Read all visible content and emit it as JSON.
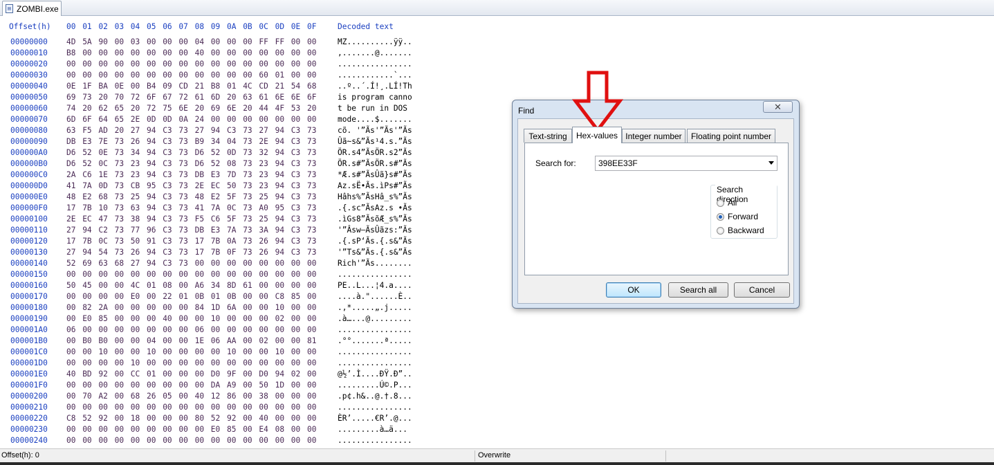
{
  "tab": {
    "label": "ZOMBI.exe",
    "icon": "file-icon"
  },
  "header": {
    "offset_label": "Offset(h)",
    "columns": [
      "00",
      "01",
      "02",
      "03",
      "04",
      "05",
      "06",
      "07",
      "08",
      "09",
      "0A",
      "0B",
      "0C",
      "0D",
      "0E",
      "0F"
    ],
    "decoded_label": "Decoded text"
  },
  "rows": [
    {
      "offset": "00000000",
      "bytes": [
        "4D",
        "5A",
        "90",
        "00",
        "03",
        "00",
        "00",
        "00",
        "04",
        "00",
        "00",
        "00",
        "FF",
        "FF",
        "00",
        "00"
      ],
      "text": "MZ..........ÿÿ.."
    },
    {
      "offset": "00000010",
      "bytes": [
        "B8",
        "00",
        "00",
        "00",
        "00",
        "00",
        "00",
        "00",
        "40",
        "00",
        "00",
        "00",
        "00",
        "00",
        "00",
        "00"
      ],
      "text": ",.......@......."
    },
    {
      "offset": "00000020",
      "bytes": [
        "00",
        "00",
        "00",
        "00",
        "00",
        "00",
        "00",
        "00",
        "00",
        "00",
        "00",
        "00",
        "00",
        "00",
        "00",
        "00"
      ],
      "text": "................"
    },
    {
      "offset": "00000030",
      "bytes": [
        "00",
        "00",
        "00",
        "00",
        "00",
        "00",
        "00",
        "00",
        "00",
        "00",
        "00",
        "00",
        "60",
        "01",
        "00",
        "00"
      ],
      "text": "............`..."
    },
    {
      "offset": "00000040",
      "bytes": [
        "0E",
        "1F",
        "BA",
        "0E",
        "00",
        "B4",
        "09",
        "CD",
        "21",
        "B8",
        "01",
        "4C",
        "CD",
        "21",
        "54",
        "68"
      ],
      "text": "..º..´.Í!¸.LÍ!Th"
    },
    {
      "offset": "00000050",
      "bytes": [
        "69",
        "73",
        "20",
        "70",
        "72",
        "6F",
        "67",
        "72",
        "61",
        "6D",
        "20",
        "63",
        "61",
        "6E",
        "6E",
        "6F"
      ],
      "text": "is program canno"
    },
    {
      "offset": "00000060",
      "bytes": [
        "74",
        "20",
        "62",
        "65",
        "20",
        "72",
        "75",
        "6E",
        "20",
        "69",
        "6E",
        "20",
        "44",
        "4F",
        "53",
        "20"
      ],
      "text": "t be run in DOS "
    },
    {
      "offset": "00000070",
      "bytes": [
        "6D",
        "6F",
        "64",
        "65",
        "2E",
        "0D",
        "0D",
        "0A",
        "24",
        "00",
        "00",
        "00",
        "00",
        "00",
        "00",
        "00"
      ],
      "text": "mode....$......."
    },
    {
      "offset": "00000080",
      "bytes": [
        "63",
        "F5",
        "AD",
        "20",
        "27",
        "94",
        "C3",
        "73",
        "27",
        "94",
        "C3",
        "73",
        "27",
        "94",
        "C3",
        "73"
      ],
      "text": "cõ. '”Ãs'”Ãs'”Ãs"
    },
    {
      "offset": "00000090",
      "bytes": [
        "DB",
        "E3",
        "7E",
        "73",
        "26",
        "94",
        "C3",
        "73",
        "B9",
        "34",
        "04",
        "73",
        "2E",
        "94",
        "C3",
        "73"
      ],
      "text": "Ûã~s&”Ãs¹4.s.”Ãs"
    },
    {
      "offset": "000000A0",
      "bytes": [
        "D6",
        "52",
        "0E",
        "73",
        "34",
        "94",
        "C3",
        "73",
        "D6",
        "52",
        "0D",
        "73",
        "32",
        "94",
        "C3",
        "73"
      ],
      "text": "ÖR.s4”ÃsÖR.s2”Ãs"
    },
    {
      "offset": "000000B0",
      "bytes": [
        "D6",
        "52",
        "0C",
        "73",
        "23",
        "94",
        "C3",
        "73",
        "D6",
        "52",
        "08",
        "73",
        "23",
        "94",
        "C3",
        "73"
      ],
      "text": "ÖR.s#”ÃsÖR.s#”Ãs"
    },
    {
      "offset": "000000C0",
      "bytes": [
        "2A",
        "C6",
        "1E",
        "73",
        "23",
        "94",
        "C3",
        "73",
        "DB",
        "E3",
        "7D",
        "73",
        "23",
        "94",
        "C3",
        "73"
      ],
      "text": "*Æ.s#”ÃsÛã}s#”Ãs"
    },
    {
      "offset": "000000D0",
      "bytes": [
        "41",
        "7A",
        "0D",
        "73",
        "CB",
        "95",
        "C3",
        "73",
        "2E",
        "EC",
        "50",
        "73",
        "23",
        "94",
        "C3",
        "73"
      ],
      "text": "Az.sË•Ãs.ìPs#”Ãs"
    },
    {
      "offset": "000000E0",
      "bytes": [
        "48",
        "E2",
        "68",
        "73",
        "25",
        "94",
        "C3",
        "73",
        "48",
        "E2",
        "5F",
        "73",
        "25",
        "94",
        "C3",
        "73"
      ],
      "text": "Hâhs%”ÃsHâ_s%”Ãs"
    },
    {
      "offset": "000000F0",
      "bytes": [
        "17",
        "7B",
        "10",
        "73",
        "63",
        "94",
        "C3",
        "73",
        "41",
        "7A",
        "0C",
        "73",
        "A0",
        "95",
        "C3",
        "73"
      ],
      "text": ".{.sc”ÃsAz.s •Ãs"
    },
    {
      "offset": "00000100",
      "bytes": [
        "2E",
        "EC",
        "47",
        "73",
        "38",
        "94",
        "C3",
        "73",
        "F5",
        "C6",
        "5F",
        "73",
        "25",
        "94",
        "C3",
        "73"
      ],
      "text": ".ìGs8”ÃsõÆ_s%”Ãs"
    },
    {
      "offset": "00000110",
      "bytes": [
        "27",
        "94",
        "C2",
        "73",
        "77",
        "96",
        "C3",
        "73",
        "DB",
        "E3",
        "7A",
        "73",
        "3A",
        "94",
        "C3",
        "73"
      ],
      "text": "'”Âsw–ÃsÛãzs:”Ãs"
    },
    {
      "offset": "00000120",
      "bytes": [
        "17",
        "7B",
        "0C",
        "73",
        "50",
        "91",
        "C3",
        "73",
        "17",
        "7B",
        "0A",
        "73",
        "26",
        "94",
        "C3",
        "73"
      ],
      "text": ".{.sP‘Ãs.{.s&”Ãs"
    },
    {
      "offset": "00000130",
      "bytes": [
        "27",
        "94",
        "54",
        "73",
        "26",
        "94",
        "C3",
        "73",
        "17",
        "7B",
        "0F",
        "73",
        "26",
        "94",
        "C3",
        "73"
      ],
      "text": "'”Ts&”Ãs.{.s&”Ãs"
    },
    {
      "offset": "00000140",
      "bytes": [
        "52",
        "69",
        "63",
        "68",
        "27",
        "94",
        "C3",
        "73",
        "00",
        "00",
        "00",
        "00",
        "00",
        "00",
        "00",
        "00"
      ],
      "text": "Rich'”Ãs........"
    },
    {
      "offset": "00000150",
      "bytes": [
        "00",
        "00",
        "00",
        "00",
        "00",
        "00",
        "00",
        "00",
        "00",
        "00",
        "00",
        "00",
        "00",
        "00",
        "00",
        "00"
      ],
      "text": "................"
    },
    {
      "offset": "00000160",
      "bytes": [
        "50",
        "45",
        "00",
        "00",
        "4C",
        "01",
        "08",
        "00",
        "A6",
        "34",
        "8D",
        "61",
        "00",
        "00",
        "00",
        "00"
      ],
      "text": "PE..L...¦4.a...."
    },
    {
      "offset": "00000170",
      "bytes": [
        "00",
        "00",
        "00",
        "00",
        "E0",
        "00",
        "22",
        "01",
        "0B",
        "01",
        "0B",
        "00",
        "00",
        "C8",
        "85",
        "00"
      ],
      "text": "....à.\"......È.."
    },
    {
      "offset": "00000180",
      "bytes": [
        "00",
        "82",
        "2A",
        "00",
        "00",
        "00",
        "00",
        "00",
        "84",
        "1D",
        "6A",
        "00",
        "00",
        "10",
        "00",
        "00"
      ],
      "text": ".,*.....„.j....."
    },
    {
      "offset": "00000190",
      "bytes": [
        "00",
        "E0",
        "85",
        "00",
        "00",
        "00",
        "40",
        "00",
        "00",
        "10",
        "00",
        "00",
        "00",
        "02",
        "00",
        "00"
      ],
      "text": ".à…...@........."
    },
    {
      "offset": "000001A0",
      "bytes": [
        "06",
        "00",
        "00",
        "00",
        "00",
        "00",
        "00",
        "00",
        "06",
        "00",
        "00",
        "00",
        "00",
        "00",
        "00",
        "00"
      ],
      "text": "................"
    },
    {
      "offset": "000001B0",
      "bytes": [
        "00",
        "B0",
        "B0",
        "00",
        "00",
        "04",
        "00",
        "00",
        "1E",
        "06",
        "AA",
        "00",
        "02",
        "00",
        "00",
        "81"
      ],
      "text": ".°°.......ª....."
    },
    {
      "offset": "000001C0",
      "bytes": [
        "00",
        "00",
        "10",
        "00",
        "00",
        "10",
        "00",
        "00",
        "00",
        "00",
        "10",
        "00",
        "00",
        "10",
        "00",
        "00"
      ],
      "text": "................"
    },
    {
      "offset": "000001D0",
      "bytes": [
        "00",
        "00",
        "00",
        "00",
        "10",
        "00",
        "00",
        "00",
        "00",
        "00",
        "00",
        "00",
        "00",
        "00",
        "00",
        "00"
      ],
      "text": "................"
    },
    {
      "offset": "000001E0",
      "bytes": [
        "40",
        "BD",
        "92",
        "00",
        "CC",
        "01",
        "00",
        "00",
        "00",
        "D0",
        "9F",
        "00",
        "D0",
        "94",
        "02",
        "00"
      ],
      "text": "@½’.Ì....ÐŸ.Ð”.."
    },
    {
      "offset": "000001F0",
      "bytes": [
        "00",
        "00",
        "00",
        "00",
        "00",
        "00",
        "00",
        "00",
        "00",
        "DA",
        "A9",
        "00",
        "50",
        "1D",
        "00",
        "00"
      ],
      "text": ".........Ú©.P..."
    },
    {
      "offset": "00000200",
      "bytes": [
        "00",
        "70",
        "A2",
        "00",
        "68",
        "26",
        "05",
        "00",
        "40",
        "12",
        "86",
        "00",
        "38",
        "00",
        "00",
        "00"
      ],
      "text": ".p¢.h&..@.†.8..."
    },
    {
      "offset": "00000210",
      "bytes": [
        "00",
        "00",
        "00",
        "00",
        "00",
        "00",
        "00",
        "00",
        "00",
        "00",
        "00",
        "00",
        "00",
        "00",
        "00",
        "00"
      ],
      "text": "................"
    },
    {
      "offset": "00000220",
      "bytes": [
        "C8",
        "52",
        "92",
        "00",
        "18",
        "00",
        "00",
        "00",
        "80",
        "52",
        "92",
        "00",
        "40",
        "00",
        "00",
        "00"
      ],
      "text": "ÈR’.....€R’.@..."
    },
    {
      "offset": "00000230",
      "bytes": [
        "00",
        "00",
        "00",
        "00",
        "00",
        "00",
        "00",
        "00",
        "00",
        "E0",
        "85",
        "00",
        "E4",
        "08",
        "00",
        "00"
      ],
      "text": ".........à…ä..."
    },
    {
      "offset": "00000240",
      "bytes": [
        "00",
        "00",
        "00",
        "00",
        "00",
        "00",
        "00",
        "00",
        "00",
        "00",
        "00",
        "00",
        "00",
        "00",
        "00",
        "00"
      ],
      "text": "................"
    }
  ],
  "statusbar": {
    "offset": "Offset(h): 0",
    "mode": "Overwrite"
  },
  "find_dialog": {
    "title": "Find",
    "close_glyph": "✕",
    "tabs": [
      "Text-string",
      "Hex-values",
      "Integer number",
      "Floating point number"
    ],
    "active_tab": "Hex-values",
    "search_label": "Search for:",
    "search_value": "398EE33F",
    "direction_label": "Search direction",
    "directions": [
      "All",
      "Forward",
      "Backward"
    ],
    "selected_direction": "Forward",
    "buttons": {
      "ok": "OK",
      "search_all": "Search all",
      "cancel": "Cancel"
    }
  },
  "colors": {
    "offset_blue": "#1a3fc0",
    "byte_text": "#4a2a55",
    "annotation_arrow": "#e01010"
  }
}
